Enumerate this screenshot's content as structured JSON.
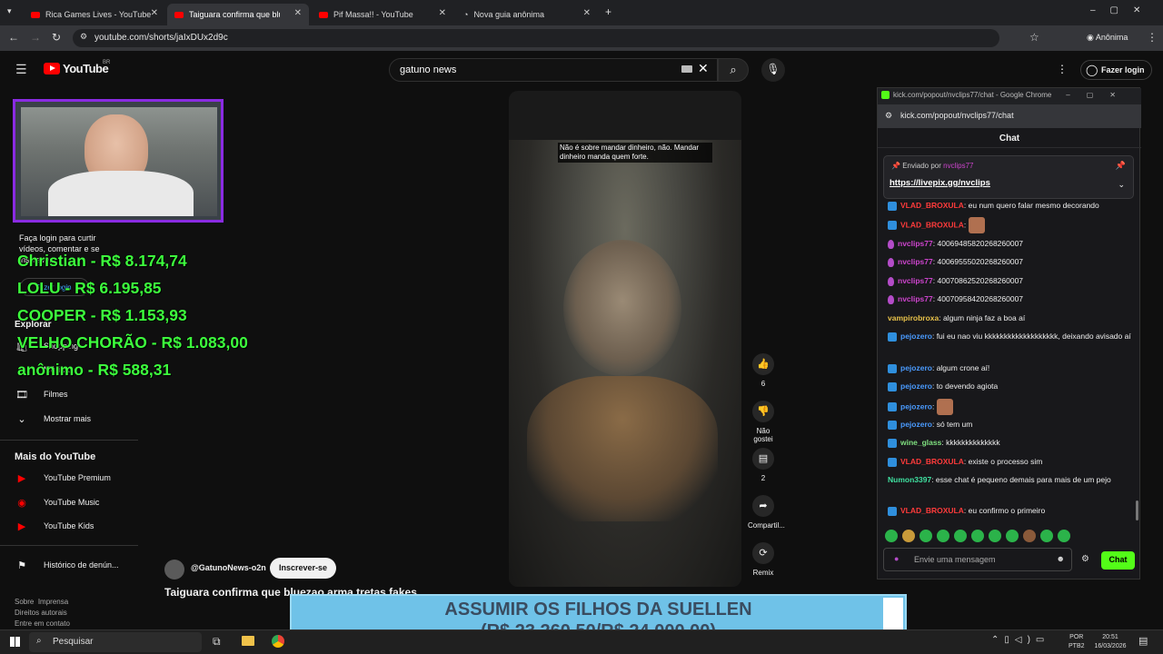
{
  "browser": {
    "tabs": [
      {
        "label": "Rica Games Lives - YouTube",
        "active": false
      },
      {
        "label": "Taiguara confirma que bluezao",
        "active": true
      },
      {
        "label": "Pif Massa!! - YouTube",
        "active": false
      },
      {
        "label": "Nova guia anônima",
        "active": false
      }
    ],
    "url": "youtube.com/shorts/jaIxDUx2d9c",
    "profile_label": "Anônima"
  },
  "youtube": {
    "logo": "YouTube",
    "region": "BR",
    "search_value": "gatuno news",
    "login_label": "Fazer login",
    "sidebar": {
      "login_prompt": "Faça login para curtir vídeos, comentar e se inscrever.",
      "login_button": "Fazer login",
      "explore_heading": "Explorar",
      "explore_items": [
        {
          "label": "Shopping",
          "icon": "shopping-icon"
        },
        {
          "label": "Música",
          "icon": "music-icon"
        },
        {
          "label": "Filmes",
          "icon": "film-icon"
        },
        {
          "label": "Mostrar mais",
          "icon": "chevron-down-icon"
        }
      ],
      "more_heading": "Mais do YouTube",
      "more_items": [
        {
          "label": "YouTube Premium"
        },
        {
          "label": "YouTube Music"
        },
        {
          "label": "YouTube Kids"
        }
      ],
      "report_history": "Histórico de denún...",
      "footer_links": [
        "Sobre",
        "Imprensa",
        "Direitos autorais",
        "Entre em contato"
      ]
    },
    "short": {
      "caption": "Não é sobre mandar dinheiro, não. Mandar dinheiro manda quem forte.",
      "channel": "@GatunoNews-o2n",
      "subscribe_label": "Inscrever-se",
      "title": "Taiguara confirma que bluezao arma tretas fakes",
      "like_count": "6",
      "dislike_label": "Não gostei",
      "comment_count": "2",
      "share_label": "Compartil...",
      "remix_label": "Remix"
    }
  },
  "overlay": {
    "donors": [
      "Christian - R$ 8.174,74",
      "LOLU - R$ 6.195,85",
      "COOPER - R$ 1.153,93",
      "VELHO CHORÃO - R$ 1.083,00",
      "anônimo - R$ 588,31"
    ],
    "goal_title": "ASSUMIR OS FILHOS DA SUELLEN",
    "goal_amount": "(R$ 23.260,50/R$ 24.000,00)",
    "goal_progress": 0.969
  },
  "chat_popup": {
    "window_title": "kick.com/popout/nvclips77/chat - Google Chrome",
    "url": "kick.com/popout/nvclips77/chat",
    "heading": "Chat",
    "pinned_by_label": "Enviado por",
    "pinned_by_user": "nvclips77",
    "pinned_link": "https://livepix.gg/nvclips",
    "messages": [
      {
        "user": "VLAD_BROXULA",
        "color": "#ff3b3b",
        "badge": "mod",
        "text": "eu num quero falar mesmo decorando"
      },
      {
        "user": "VLAD_BROXULA",
        "color": "#ff3b3b",
        "badge": "mod",
        "text": "[emote]"
      },
      {
        "user": "nvclips77",
        "color": "#cc44cc",
        "badge": "mic",
        "text": "40069485820268260007"
      },
      {
        "user": "nvclips77",
        "color": "#cc44cc",
        "badge": "mic",
        "text": "40069555020268260007"
      },
      {
        "user": "nvclips77",
        "color": "#cc44cc",
        "badge": "mic",
        "text": "40070862520268260007"
      },
      {
        "user": "nvclips77",
        "color": "#cc44cc",
        "badge": "mic",
        "text": "40070958420268260007"
      },
      {
        "user": "vampirobroxa",
        "color": "#e8c24a",
        "badge": "none",
        "text": "algum ninja faz a boa aí"
      },
      {
        "user": "pejozero",
        "color": "#4a9bff",
        "badge": "mod",
        "text": "fui eu nao viu kkkkkkkkkkkkkkkkkkk, deixando avisado aí"
      },
      {
        "user": "pejozero",
        "color": "#4a9bff",
        "badge": "mod",
        "text": "algum crone aí!"
      },
      {
        "user": "pejozero",
        "color": "#4a9bff",
        "badge": "mod",
        "text": "to devendo agiota"
      },
      {
        "user": "pejozero",
        "color": "#4a9bff",
        "badge": "mod",
        "text": "[emote]"
      },
      {
        "user": "pejozero",
        "color": "#4a9bff",
        "badge": "mod",
        "text": "só tem um"
      },
      {
        "user": "wine_glass",
        "color": "#7fe07f",
        "badge": "mod",
        "text": "kkkkkkkkkkkkkk"
      },
      {
        "user": "VLAD_BROXULA",
        "color": "#ff3b3b",
        "badge": "mod",
        "text": "existe o processo sim"
      },
      {
        "user": "Numon3397",
        "color": "#3fe0a0",
        "badge": "none",
        "text": "esse chat é pequeno demais para mais de um pejo"
      },
      {
        "user": "VLAD_BROXULA",
        "color": "#ff3b3b",
        "badge": "mod",
        "text": "eu confirmo o primeiro"
      }
    ],
    "input_placeholder": "Envie uma mensagem",
    "send_label": "Chat"
  },
  "taskbar": {
    "search_placeholder": "Pesquisar",
    "lang": "POR",
    "layout": "PTB2",
    "time": "20:51",
    "date": "16/03/2026"
  }
}
